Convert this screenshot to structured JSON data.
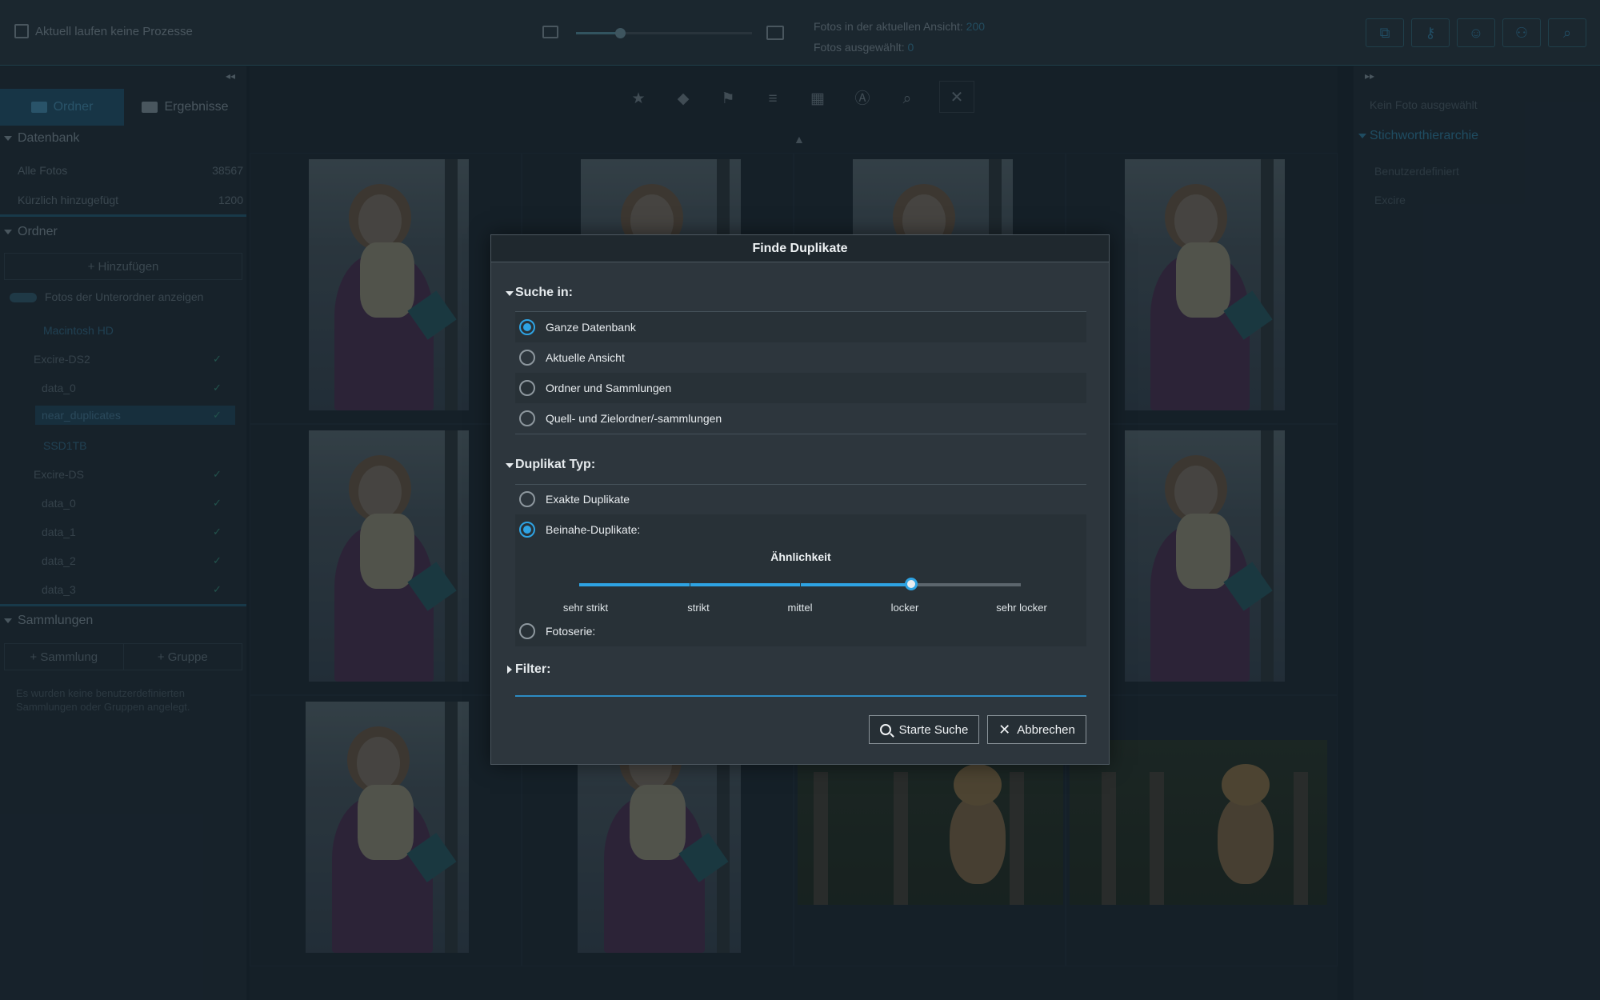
{
  "topbar": {
    "process_status": "Aktuell laufen keine Prozesse",
    "stats_view_label": "Fotos in der aktuellen Ansicht:",
    "stats_view_value": "200",
    "stats_selected_label": "Fotos ausgewählt:",
    "stats_selected_value": "0",
    "zoom_level": 0.2
  },
  "left": {
    "tabs": [
      {
        "label": "Ordner"
      },
      {
        "label": "Ergebnisse"
      }
    ],
    "database": {
      "title": "Datenbank",
      "items": [
        {
          "label": "Alle Fotos",
          "count": "38567"
        },
        {
          "label": "Kürzlich hinzugefügt",
          "count": "1200"
        }
      ]
    },
    "folders": {
      "title": "Ordner",
      "add_label": "Hinzufügen",
      "subfolder_toggle_label": "Fotos der Unterordner anzeigen",
      "tree": [
        {
          "label": "Macintosh HD"
        },
        {
          "label": "Excire-DS2"
        },
        {
          "label": "data_0"
        },
        {
          "label": "near_duplicates"
        },
        {
          "label": "SSD1TB"
        },
        {
          "label": "Excire-DS"
        },
        {
          "label": "data_0"
        },
        {
          "label": "data_1"
        },
        {
          "label": "data_2"
        },
        {
          "label": "data_3"
        }
      ]
    },
    "collections": {
      "title": "Sammlungen",
      "add_collection": "Sammlung",
      "add_group": "Gruppe",
      "empty_note": "Es wurden keine benutzerdefinierten Sammlungen oder Gruppen angelegt."
    }
  },
  "right": {
    "no_photo": "Kein Foto ausgewählt",
    "section_title": "Stichworthierarchie",
    "items": [
      {
        "label": "Benutzerdefiniert"
      },
      {
        "label": "Excire"
      }
    ]
  },
  "dialog": {
    "title": "Finde Duplikate",
    "search_in": {
      "title": "Suche in:",
      "options": [
        {
          "label": "Ganze Datenbank",
          "selected": true
        },
        {
          "label": "Aktuelle Ansicht",
          "selected": false
        },
        {
          "label": "Ordner und Sammlungen",
          "selected": false
        },
        {
          "label": "Quell- und Zielordner/-sammlungen",
          "selected": false
        }
      ]
    },
    "duplicate_type": {
      "title": "Duplikat Typ:",
      "exact_label": "Exakte Duplikate",
      "near_label": "Beinahe-Duplikate:",
      "similarity_title": "Ähnlichkeit",
      "similarity_levels": [
        "sehr strikt",
        "strikt",
        "mittel",
        "locker",
        "sehr locker"
      ],
      "similarity_value": "locker",
      "series_label": "Fotoserie:"
    },
    "filter_title": "Filter:",
    "start_label": "Starte Suche",
    "cancel_label": "Abbrechen"
  }
}
